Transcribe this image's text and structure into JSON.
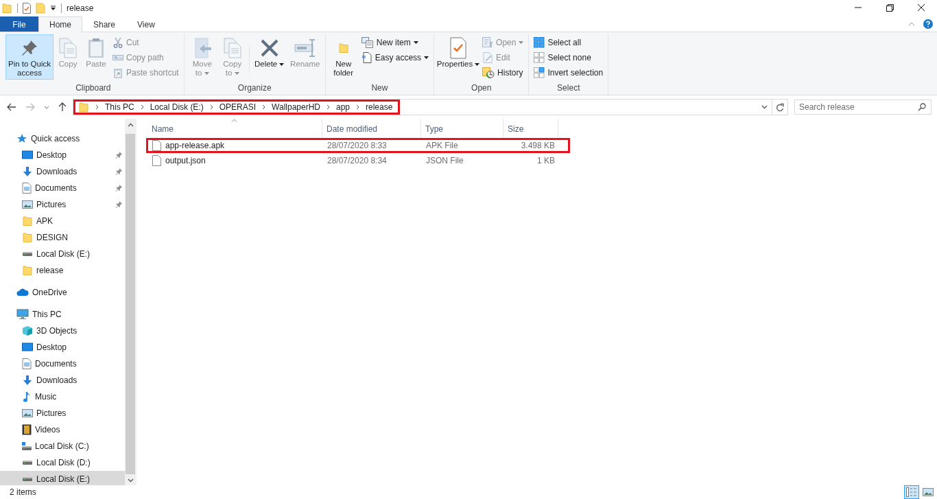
{
  "window": {
    "title": "release"
  },
  "ribbon": {
    "tabs": [
      {
        "label": "File",
        "kind": "file",
        "selected": false
      },
      {
        "label": "Home",
        "kind": "tab",
        "selected": true
      },
      {
        "label": "Share",
        "kind": "tab",
        "selected": false
      },
      {
        "label": "View",
        "kind": "tab",
        "selected": false
      }
    ],
    "groups": [
      {
        "label": "Clipboard",
        "items": [
          {
            "label": "Pin to Quick access",
            "kind": "large",
            "disabled": false,
            "highlighted": true,
            "dropdown": false
          },
          {
            "label": "Copy",
            "kind": "large",
            "disabled": true,
            "highlighted": false,
            "dropdown": false
          },
          {
            "label": "Paste",
            "kind": "large",
            "disabled": true,
            "highlighted": false,
            "dropdown": false
          },
          {
            "label": "Cut",
            "kind": "small",
            "disabled": true,
            "highlighted": false,
            "dropdown": false
          },
          {
            "label": "Copy path",
            "kind": "small",
            "disabled": true,
            "highlighted": false,
            "dropdown": false
          },
          {
            "label": "Paste shortcut",
            "kind": "small",
            "disabled": true,
            "highlighted": false,
            "dropdown": false
          }
        ]
      },
      {
        "label": "Organize",
        "items": [
          {
            "label": "Move to",
            "kind": "large",
            "disabled": true,
            "highlighted": false,
            "dropdown": true
          },
          {
            "label": "Copy to",
            "kind": "large",
            "disabled": true,
            "highlighted": false,
            "dropdown": true
          },
          {
            "label": "Delete",
            "kind": "large",
            "disabled": false,
            "highlighted": false,
            "dropdown": true
          },
          {
            "label": "Rename",
            "kind": "large",
            "disabled": true,
            "highlighted": false,
            "dropdown": false
          }
        ]
      },
      {
        "label": "New",
        "items": [
          {
            "label": "New folder",
            "kind": "large",
            "disabled": false,
            "highlighted": false,
            "dropdown": false
          },
          {
            "label": "New item",
            "kind": "small",
            "disabled": false,
            "highlighted": false,
            "dropdown": true
          },
          {
            "label": "Easy access",
            "kind": "small",
            "disabled": false,
            "highlighted": false,
            "dropdown": true
          }
        ]
      },
      {
        "label": "Open",
        "items": [
          {
            "label": "Properties",
            "kind": "large",
            "disabled": false,
            "highlighted": false,
            "dropdown": true
          },
          {
            "label": "Open",
            "kind": "small",
            "disabled": true,
            "highlighted": false,
            "dropdown": true
          },
          {
            "label": "Edit",
            "kind": "small",
            "disabled": true,
            "highlighted": false,
            "dropdown": false
          },
          {
            "label": "History",
            "kind": "small",
            "disabled": false,
            "highlighted": false,
            "dropdown": false
          }
        ]
      },
      {
        "label": "Select",
        "items": [
          {
            "label": "Select all",
            "kind": "small",
            "disabled": false,
            "highlighted": false,
            "dropdown": false
          },
          {
            "label": "Select none",
            "kind": "small",
            "disabled": false,
            "highlighted": false,
            "dropdown": false
          },
          {
            "label": "Invert selection",
            "kind": "small",
            "disabled": false,
            "highlighted": false,
            "dropdown": false
          }
        ]
      }
    ]
  },
  "address_bar": {
    "highlighted": true,
    "crumbs": [
      "This PC",
      "Local Disk (E:)",
      "OPERASI",
      "WallpaperHD",
      "app",
      "release"
    ]
  },
  "search": {
    "placeholder": "Search release"
  },
  "sidebar": {
    "items": [
      {
        "label": "Quick access",
        "selected": false,
        "pinned": false,
        "children": [
          {
            "label": "Desktop",
            "selected": false,
            "pinned": true
          },
          {
            "label": "Downloads",
            "selected": false,
            "pinned": true
          },
          {
            "label": "Documents",
            "selected": false,
            "pinned": true
          },
          {
            "label": "Pictures",
            "selected": false,
            "pinned": true
          },
          {
            "label": "APK",
            "selected": false,
            "pinned": false
          },
          {
            "label": "DESIGN",
            "selected": false,
            "pinned": false
          },
          {
            "label": "Local Disk (E:)",
            "selected": false,
            "pinned": false
          },
          {
            "label": "release",
            "selected": false,
            "pinned": false
          }
        ]
      },
      {
        "label": "OneDrive",
        "selected": false,
        "pinned": false
      },
      {
        "label": "This PC",
        "selected": false,
        "pinned": false,
        "children": [
          {
            "label": "3D Objects",
            "selected": false,
            "pinned": false
          },
          {
            "label": "Desktop",
            "selected": false,
            "pinned": false
          },
          {
            "label": "Documents",
            "selected": false,
            "pinned": false
          },
          {
            "label": "Downloads",
            "selected": false,
            "pinned": false
          },
          {
            "label": "Music",
            "selected": false,
            "pinned": false
          },
          {
            "label": "Pictures",
            "selected": false,
            "pinned": false
          },
          {
            "label": "Videos",
            "selected": false,
            "pinned": false
          },
          {
            "label": "Local Disk (C:)",
            "selected": false,
            "pinned": false
          },
          {
            "label": "Local Disk (D:)",
            "selected": false,
            "pinned": false
          },
          {
            "label": "Local Disk (E:)",
            "selected": true,
            "pinned": false
          }
        ]
      }
    ]
  },
  "table": {
    "columns": [
      "Name",
      "Date modified",
      "Type",
      "Size"
    ],
    "rows": [
      {
        "cells": [
          "app-release.apk",
          "28/07/2020 8:33",
          "APK File",
          "3.498 KB"
        ],
        "selected": false,
        "highlighted": true
      },
      {
        "cells": [
          "output.json",
          "28/07/2020 8:34",
          "JSON File",
          "1 KB"
        ],
        "selected": false,
        "highlighted": false
      }
    ]
  },
  "status_bar": {
    "text": "2 items"
  },
  "views": [
    {
      "kind": "details",
      "selected": true
    },
    {
      "kind": "thumbnails",
      "selected": false
    }
  ]
}
